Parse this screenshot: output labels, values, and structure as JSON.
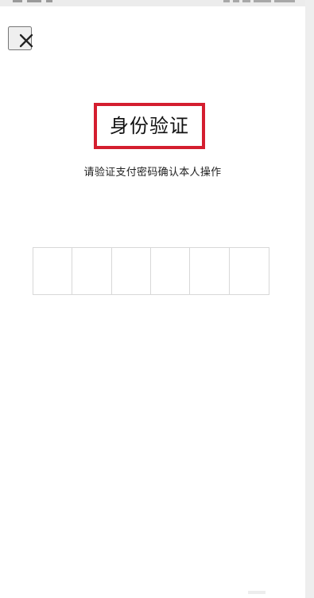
{
  "header": {
    "close_icon": "close-icon"
  },
  "main": {
    "title": "身份验证",
    "subtitle": "请验证支付密码确认本人操作",
    "pin_cells": [
      "",
      "",
      "",
      "",
      "",
      ""
    ]
  },
  "colors": {
    "highlight_border": "#d41e2f",
    "text_primary": "#111111",
    "grid_border": "#d8d8d8",
    "background": "#ffffff"
  }
}
